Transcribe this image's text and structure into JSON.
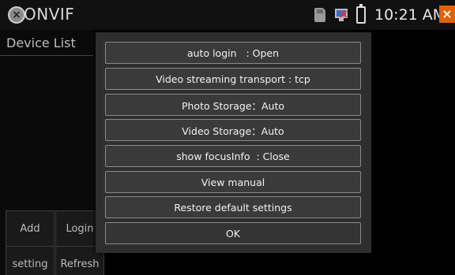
{
  "statusbar": {
    "app_title": "ONVIF",
    "app_icon": "close-circle-icon",
    "icons": [
      "sd-card-icon",
      "network-disconnected-icon",
      "battery-icon"
    ],
    "time": "10:21 AM",
    "close_icon": "close-icon"
  },
  "sidebar": {
    "title": "Device List",
    "buttons": [
      {
        "label": "Add"
      },
      {
        "label": "Login"
      },
      {
        "label": "setting"
      },
      {
        "label": "Refresh"
      }
    ]
  },
  "dialog": {
    "items": [
      {
        "label": "auto login   : Open"
      },
      {
        "label": "Video streaming transport : tcp"
      },
      {
        "label": "Photo Storage：Auto"
      },
      {
        "label": "Video Storage：Auto"
      },
      {
        "label": "show focusInfo  : Close"
      },
      {
        "label": "View manual"
      },
      {
        "label": "Restore default settings"
      },
      {
        "label": "OK"
      }
    ]
  },
  "colors": {
    "dialog_bg": "#2e2e2e",
    "button_border": "#8a8a8a",
    "close_accent": "#e0620a"
  }
}
